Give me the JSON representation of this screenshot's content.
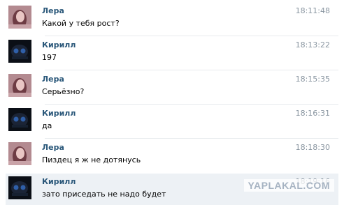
{
  "messages": [
    {
      "author": "Лера",
      "avatar": "female-avatar-icon",
      "time": "18:11:48",
      "text": "Какой у тебя рост?"
    },
    {
      "author": "Кирилл",
      "avatar": "dark-avatar-icon",
      "time": "18:13:22",
      "text": "197"
    },
    {
      "author": "Лера",
      "avatar": "female-avatar-icon",
      "time": "18:15:35",
      "text": "Серьёзно?"
    },
    {
      "author": "Кирилл",
      "avatar": "dark-avatar-icon",
      "time": "18:16:31",
      "text": "да"
    },
    {
      "author": "Лера",
      "avatar": "female-avatar-icon",
      "time": "18:18:30",
      "text": "Пиздец я ж не дотянусь"
    },
    {
      "author": "Кирилл",
      "avatar": "dark-avatar-icon",
      "time": "18:19:16",
      "text": "зато приседать не надо будет"
    }
  ],
  "watermark": "YAPLAKAL.COM",
  "colors": {
    "author": "#2b587a",
    "time": "#8a96a1",
    "highlight": "#edf1f5"
  }
}
